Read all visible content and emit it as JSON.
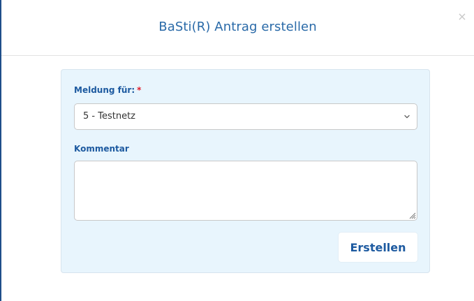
{
  "dialog": {
    "title": "BaSti(R) Antrag erstellen",
    "close_symbol": "×"
  },
  "form": {
    "meldung_label": "Meldung für:",
    "required_marker": "*",
    "meldung_selected": "5 - Testnetz",
    "kommentar_label": "Kommentar",
    "kommentar_value": "",
    "submit_label": "Erstellen"
  },
  "icons": {
    "close": "close-icon",
    "select_arrow": "chevron-down-icon",
    "resize": "resize-grip-icon"
  },
  "colors": {
    "title": "#2a6aa8",
    "label": "#1d5aa0",
    "required": "#e11b2a",
    "panel_background": "#e8f5fd",
    "left_border": "#1f4e8a"
  }
}
